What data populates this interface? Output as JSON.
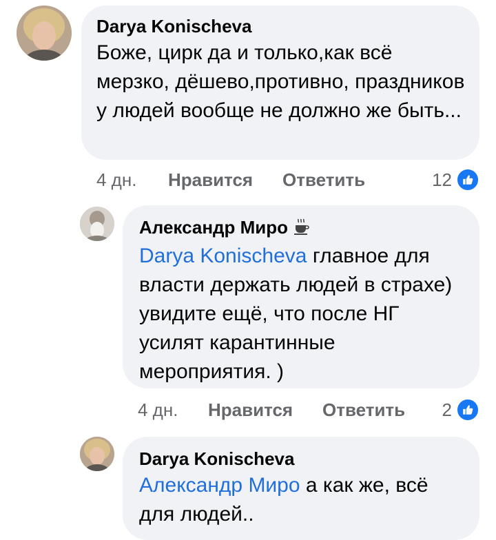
{
  "comments": [
    {
      "author": "Darya Konischeva",
      "text": "Боже, цирк да и только,как всё мерзко, дёшево,противно, праздников у людей вообще не должно же быть...",
      "time": "4 дн.",
      "like_label": "Нравится",
      "reply_label": "Ответить",
      "reaction_count": "12"
    },
    {
      "author": "Александр Миро",
      "author_icon": "coffee-cup-icon",
      "mention": "Darya Konischeva",
      "text": "главное для власти держать людей в страхе) увидите ещё, что после НГ усилят карантинные мероприятия. )",
      "time": "4 дн.",
      "like_label": "Нравится",
      "reply_label": "Ответить",
      "reaction_count": "2"
    },
    {
      "author": "Darya Konischeva",
      "mention": "Александр Миро",
      "text": "а как же, всё для людей.."
    }
  ],
  "colors": {
    "bubble": "#f0f2f5",
    "mention": "#216fdb",
    "meta": "#65676b",
    "like_badge": "#1877f2"
  }
}
